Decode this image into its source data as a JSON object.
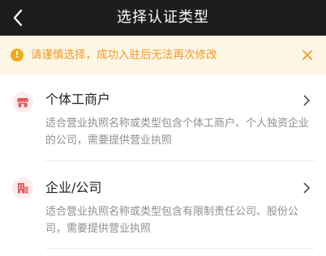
{
  "header": {
    "title": "选择认证类型",
    "back_icon": "chevron-left-icon"
  },
  "notice": {
    "text": "请谨慎选择，成功入驻后无法再次修改",
    "color": "#f09a25",
    "background": "#fdf6e5",
    "info_icon": "warning-circle-icon",
    "info_glyph": "!",
    "close_icon": "close-icon"
  },
  "options": [
    {
      "title": "个体工商户",
      "desc": "适合营业执照名称或类型包含个体工商户、个人独资企业的公司，需要提供营业执照",
      "icon": "storefront-icon"
    },
    {
      "title": "企业/公司",
      "desc": "适合营业执照名称或类型包含有限制责任公司、股份公司，需要提供营业执照",
      "icon": "building-icon"
    }
  ],
  "colors": {
    "navbar": "#1d1d1d",
    "accent_icon": "#e25a5a"
  }
}
